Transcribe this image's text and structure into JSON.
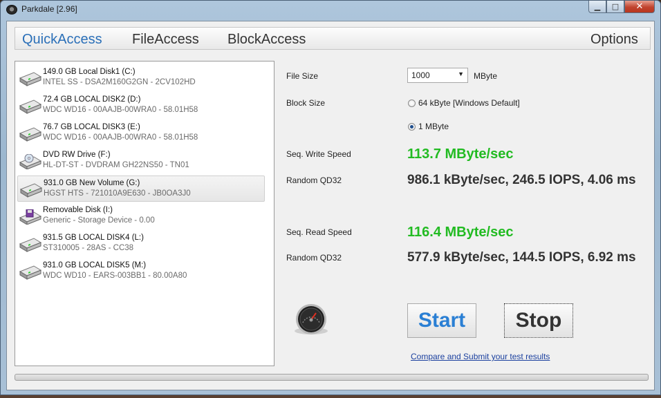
{
  "window": {
    "title": "Parkdale [2.96]"
  },
  "caption": {
    "minimize": "▁",
    "maximize": "□",
    "close": "✕"
  },
  "nav": {
    "quick": "QuickAccess",
    "file": "FileAccess",
    "block": "BlockAccess",
    "options": "Options"
  },
  "drives": [
    {
      "name": "149.0 GB Local Disk1 (C:)",
      "desc": "INTEL SS - DSA2M160G2GN - 2CV102HD",
      "icon": "hard-drive-icon"
    },
    {
      "name": "72.4 GB LOCAL DISK2 (D:)",
      "desc": "WDC WD16 - 00AAJB-00WRA0 - 58.01H58",
      "icon": "hard-drive-icon"
    },
    {
      "name": "76.7 GB LOCAL DISK3 (E:)",
      "desc": "WDC WD16 - 00AAJB-00WRA0 - 58.01H58",
      "icon": "hard-drive-icon"
    },
    {
      "name": "DVD RW Drive (F:)",
      "desc": "HL-DT-ST - DVDRAM GH22NS50 - TN01",
      "icon": "dvd-drive-icon"
    },
    {
      "name": "931.0 GB New Volume (G:)",
      "desc": "HGST HTS - 721010A9E630 - JB0OA3J0",
      "icon": "hard-drive-icon",
      "selected": true
    },
    {
      "name": "Removable Disk (I:)",
      "desc": "Generic - Storage Device - 0.00",
      "icon": "removable-disk-icon"
    },
    {
      "name": "931.5 GB LOCAL DISK4 (L:)",
      "desc": "ST310005 - 28AS - CC38",
      "icon": "hard-drive-icon"
    },
    {
      "name": "931.0 GB LOCAL DISK5 (M:)",
      "desc": "WDC WD10 - EARS-003BB1 - 80.00A80",
      "icon": "hard-drive-icon"
    }
  ],
  "settings": {
    "file_size_label": "File Size",
    "file_size_value": "1000",
    "file_size_unit": "MByte",
    "block_size_label": "Block Size",
    "block_opt1": "64 kByte [Windows Default]",
    "block_opt2": "1 MByte",
    "selected_block": "1 MByte"
  },
  "results": {
    "seq_write_label": "Seq. Write Speed",
    "seq_write_value": "113.7 MByte/sec",
    "rand_write_label": "Random QD32",
    "rand_write_value": "986.1 kByte/sec, 246.5 IOPS, 4.06 ms",
    "seq_read_label": "Seq. Read Speed",
    "seq_read_value": "116.4 MByte/sec",
    "rand_read_label": "Random QD32",
    "rand_read_value": "577.9 kByte/sec, 144.5 IOPS, 6.92 ms"
  },
  "buttons": {
    "start": "Start",
    "stop": "Stop"
  },
  "link": "Compare and Submit your test results",
  "progress": {
    "fraction": 0
  },
  "colors": {
    "accent": "#2a6fb8",
    "speed": "#22bb22",
    "start": "#2a7fd4"
  }
}
